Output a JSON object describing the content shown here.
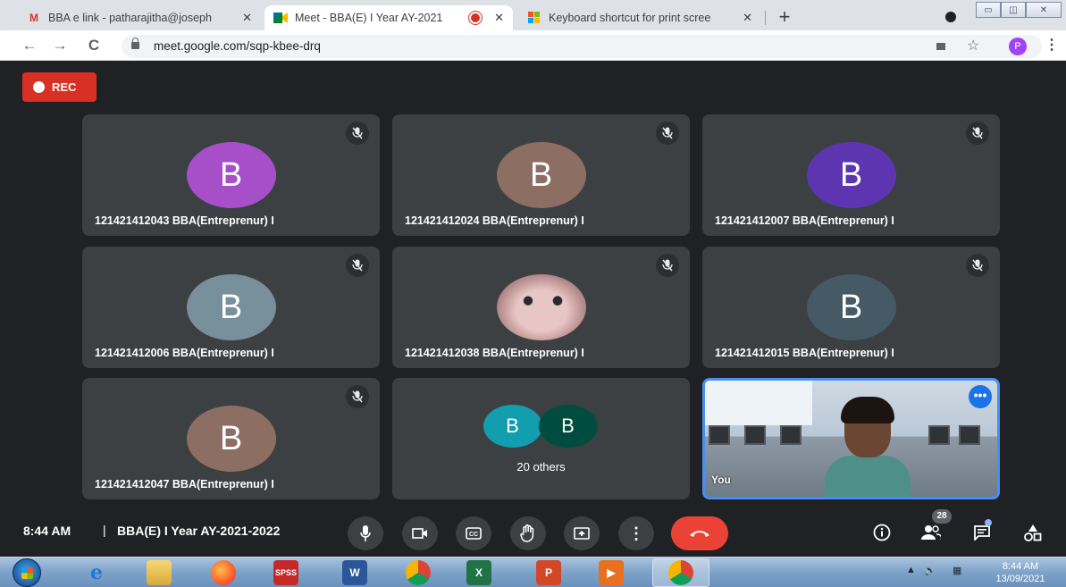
{
  "browser": {
    "tabs": [
      {
        "title": "BBA e link - patharajitha@joseph",
        "favicon": "gmail-icon"
      },
      {
        "title": "Meet - BBA(E) I Year AY-2021",
        "favicon": "meet-icon",
        "recording": true
      },
      {
        "title": "Keyboard shortcut for print scree",
        "favicon": "microsoft-icon"
      }
    ],
    "url": "meet.google.com/sqp-kbee-drq",
    "profile_initial": "P"
  },
  "meeting": {
    "rec_label": "REC",
    "participants": [
      {
        "name": "121421412043 BBA(Entreprenur) I",
        "initial": "B",
        "color": "#a74fc9",
        "muted": true
      },
      {
        "name": "121421412024 BBA(Entreprenur) I",
        "initial": "B",
        "color": "#8d6e63",
        "muted": true
      },
      {
        "name": "121421412007 BBA(Entreprenur) I",
        "initial": "B",
        "color": "#5e35b1",
        "muted": true
      },
      {
        "name": "121421412006 BBA(Entreprenur) I",
        "initial": "B",
        "color": "#78909c",
        "muted": true
      },
      {
        "name": "121421412038 BBA(Entreprenur) I",
        "initial": "",
        "color": "photo",
        "muted": true
      },
      {
        "name": "121421412015 BBA(Entreprenur) I",
        "initial": "B",
        "color": "#455a64",
        "muted": true
      },
      {
        "name": "121421412047 BBA(Entreprenur) I",
        "initial": "B",
        "color": "#8d6e63",
        "muted": true
      }
    ],
    "others": {
      "label": "20 others",
      "avatars": [
        {
          "initial": "B",
          "color": "#129eaf"
        },
        {
          "initial": "B",
          "color": "#004d40"
        }
      ]
    },
    "self_label": "You",
    "self_more": "•••"
  },
  "controls": {
    "time": "8:44 AM",
    "separator": "|",
    "meeting_name": "BBA(E) I Year AY-2021-2022",
    "participant_count": "28"
  },
  "taskbar": {
    "time": "8:44 AM",
    "date": "13/09/2021"
  }
}
